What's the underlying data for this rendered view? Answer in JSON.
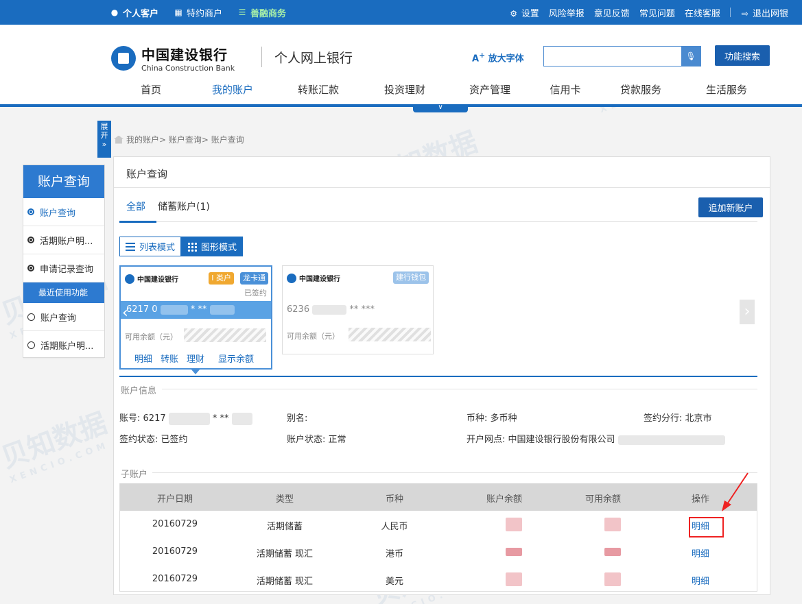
{
  "topbar": {
    "personal": "个人客户",
    "merchant": "特约商户",
    "shanrong": "善融商务",
    "settings": "设置",
    "risk_report": "风险举报",
    "feedback": "意见反馈",
    "faq": "常见问题",
    "online_service": "在线客服",
    "logout": "退出网银"
  },
  "header": {
    "bank_name_cn": "中国建设银行",
    "bank_name_en": "China Construction Bank",
    "product": "个人网上银行",
    "font_size": "放大字体",
    "search_placeholder": "",
    "function_search": "功能搜索"
  },
  "nav": [
    "首页",
    "我的账户",
    "转账汇款",
    "投资理财",
    "资产管理",
    "信用卡",
    "贷款服务",
    "生活服务"
  ],
  "expand": "展开",
  "breadcrumb": "我的账户> 账户查询> 账户查询",
  "sidebar": {
    "title": "账户查询",
    "items": [
      "账户查询",
      "活期账户明...",
      "申请记录查询"
    ],
    "recent_title": "最近使用功能",
    "recent_items": [
      "账户查询",
      "活期账户明..."
    ]
  },
  "main": {
    "title": "账户查询",
    "tabs": [
      "全部",
      "储蓄账户(1)"
    ],
    "add_account": "追加新账户",
    "mode_list": "列表模式",
    "mode_graphic": "图形模式"
  },
  "cards": [
    {
      "bank": "中国建设银行",
      "badges": [
        "I 类户",
        "龙卡通"
      ],
      "status": "已签约",
      "number": "6217 0",
      "number_tail": "* **",
      "balance_label": "可用余额（元）",
      "actions": [
        "明细",
        "转账",
        "理财",
        "显示余额"
      ]
    },
    {
      "bank": "中国建设银行",
      "badges": [
        "建行钱包"
      ],
      "number": "6236",
      "number_tail": "** ***",
      "balance_label": "可用余额（元）"
    }
  ],
  "account_info": {
    "section_title": "账户信息",
    "account_no_label": "账号:",
    "account_no_value": "6217",
    "account_no_tail": "* **",
    "alias_label": "别名:",
    "currency_label": "币种:",
    "currency_value": "多币种",
    "branch_label": "签约分行:",
    "branch_value": "北京市",
    "sign_status_label": "签约状态:",
    "sign_status_value": "已签约",
    "acct_status_label": "账户状态:",
    "acct_status_value": "正常",
    "outlet_label": "开户网点:",
    "outlet_value": "中国建设银行股份有限公司"
  },
  "sub_accounts": {
    "section_title": "子账户",
    "columns": [
      "开户日期",
      "类型",
      "币种",
      "账户余额",
      "可用余额",
      "操作"
    ],
    "rows": [
      {
        "date": "20160729",
        "type": "活期储蓄",
        "currency": "人民币",
        "action": "明细"
      },
      {
        "date": "20160729",
        "type": "活期储蓄 现汇",
        "currency": "港币",
        "action": "明细"
      },
      {
        "date": "20160729",
        "type": "活期储蓄 现汇",
        "currency": "美元",
        "action": "明细"
      }
    ]
  },
  "colors": {
    "brand_blue": "#1a6cbf",
    "highlight_red": "#e22222"
  }
}
